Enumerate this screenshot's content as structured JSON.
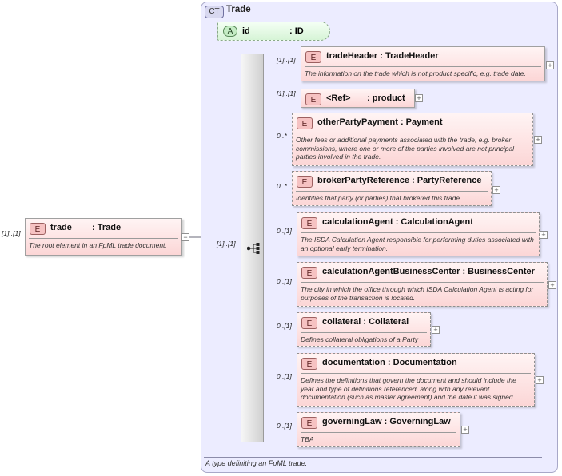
{
  "complex_type": {
    "badge": "CT",
    "name": "Trade",
    "description": "A type definiting an FpML trade."
  },
  "root": {
    "cardinality": "[1]..[1]",
    "badge": "E",
    "name": "trade",
    "type": ": Trade",
    "description": "The root element in an FpML trade document."
  },
  "attribute": {
    "badge": "A",
    "name": "id",
    "type": ": ID"
  },
  "sequence": {
    "cardinality": "[1]..[1]",
    "icon": "sequence-icon"
  },
  "elements": [
    {
      "cardinality": "[1]..[1]",
      "badge": "E",
      "name": "tradeHeader",
      "type": ": TradeHeader",
      "description": "The information on the trade which is not product specific, e.g. trade date."
    },
    {
      "cardinality": "[1]..[1]",
      "badge": "E",
      "name": "<Ref>",
      "type": ": product",
      "description": ""
    },
    {
      "cardinality": "0..*",
      "badge": "E",
      "name": "otherPartyPayment",
      "type": ": Payment",
      "description": "Other fees or additional payments associated with the trade, e.g. broker commissions, where one or more of the parties involved are not principal parties involved in the trade."
    },
    {
      "cardinality": "0..*",
      "badge": "E",
      "name": "brokerPartyReference",
      "type": ": PartyReference",
      "description": "Identifies that party (or parties) that brokered this trade."
    },
    {
      "cardinality": "0..[1]",
      "badge": "E",
      "name": "calculationAgent",
      "type": ": CalculationAgent",
      "description": "The ISDA Calculation Agent responsible for performing duties associated with an optional early termination."
    },
    {
      "cardinality": "0..[1]",
      "badge": "E",
      "name": "calculationAgentBusinessCenter",
      "type": ": BusinessCenter",
      "description": "The city in which the office through which ISDA Calculation Agent is acting for purposes of the transaction is located."
    },
    {
      "cardinality": "0..[1]",
      "badge": "E",
      "name": "collateral",
      "type": ": Collateral",
      "description": "Defines collateral obligations of a Party"
    },
    {
      "cardinality": "0..[1]",
      "badge": "E",
      "name": "documentation",
      "type": ": Documentation",
      "description": "Defines the definitions that govern the document and should include the year and type of definitions referenced, along with any relevant documentation (such as master agreement) and the date it was signed."
    },
    {
      "cardinality": "0..[1]",
      "badge": "E",
      "name": "governingLaw",
      "type": ": GoverningLaw",
      "description": "TBA"
    }
  ],
  "colors": {
    "complex_type_bg": "#ececff",
    "element_fill": "#fcd6d6",
    "attribute_fill": "#d6f4d6"
  }
}
